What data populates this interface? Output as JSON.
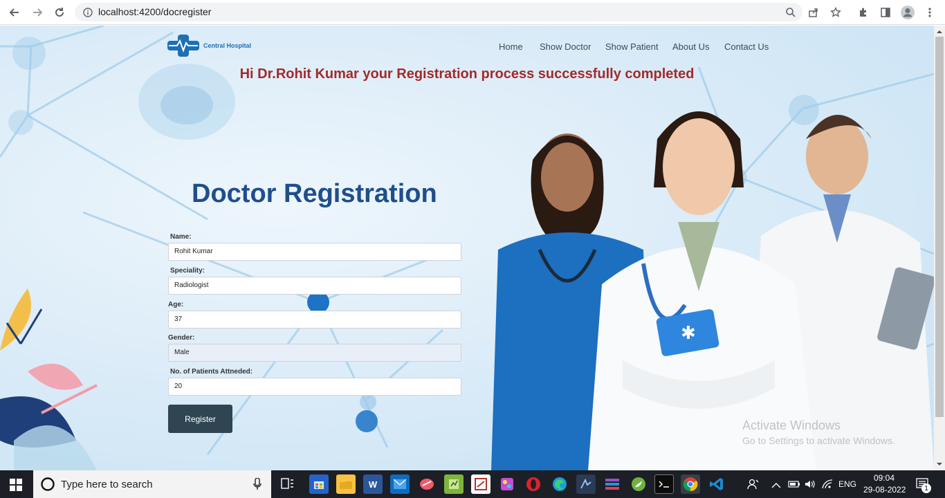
{
  "browser": {
    "url": "localhost:4200/docregister"
  },
  "site": {
    "brand": "Central Hospital",
    "nav": [
      "Home",
      "Show Doctor",
      "Show Patient",
      "About Us",
      "Contact Us"
    ],
    "success_message": "Hi Dr.Rohit Kumar your Registration process successfully completed",
    "form": {
      "title": "Doctor Registration",
      "name_label": "Name:",
      "name_value": "Rohit Kumar",
      "speciality_label": "Speciality:",
      "speciality_value": "Radiologist",
      "age_label": "Age:",
      "age_value": "37",
      "gender_label": "Gender:",
      "gender_value": "Male",
      "patients_label": "No. of Patients Attneded:",
      "patients_value": "20",
      "register_label": "Register"
    }
  },
  "watermark": {
    "line1": "Activate Windows",
    "line2": "Go to Settings to activate Windows."
  },
  "taskbar": {
    "search_placeholder": "Type here to search",
    "language": "ENG",
    "time": "09:04",
    "date": "29-08-2022",
    "notification_count": "1"
  },
  "colors": {
    "success": "#a32a2a",
    "title": "#1f4e8c",
    "button": "#2f4652"
  }
}
